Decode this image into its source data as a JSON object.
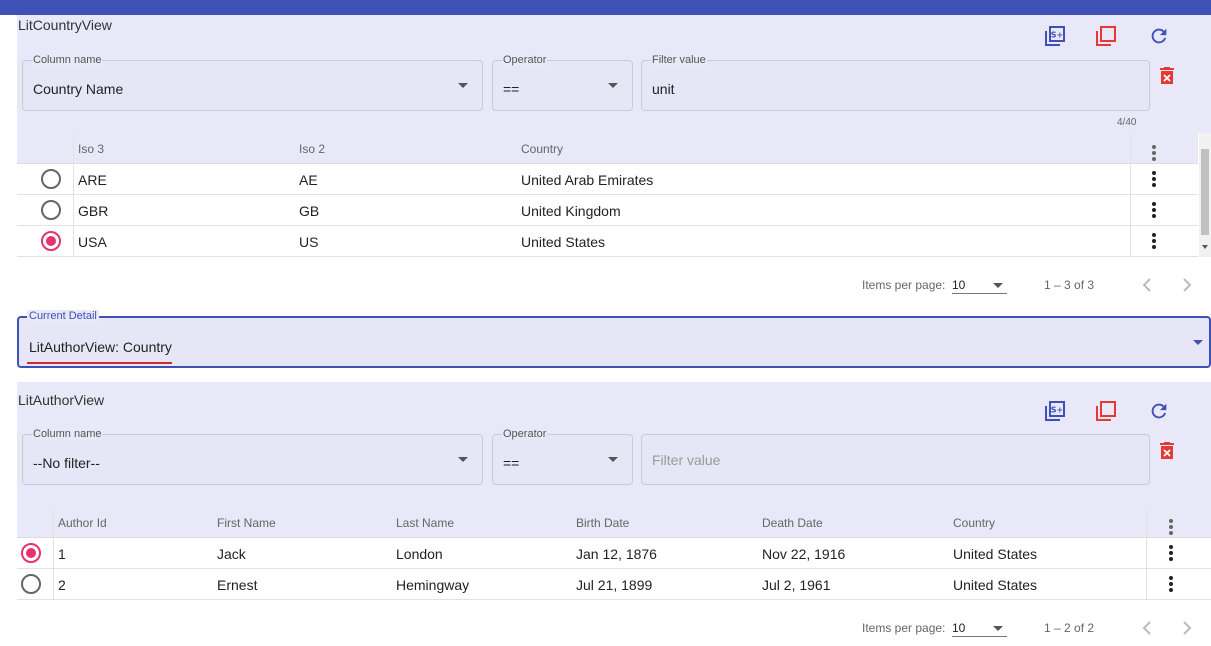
{
  "colors": {
    "primary": "#3f51b5",
    "accent": "#e5336e",
    "warn": "#e53935",
    "panel_bg": "#e8e8f8"
  },
  "country_view": {
    "title": "LitCountryView",
    "toolbar": {
      "add_icon": "library-add-icon",
      "copy_icon": "copy-icon",
      "refresh_icon": "refresh-icon",
      "delete_icon": "delete-filter-icon"
    },
    "filter": {
      "column_label": "Column name",
      "column_value": "Country Name",
      "operator_label": "Operator",
      "operator_value": "==",
      "value_label": "Filter value",
      "value_text": "unit",
      "char_count": "4/40"
    },
    "table": {
      "columns": [
        "Iso 3",
        "Iso 2",
        "Country"
      ],
      "rows": [
        {
          "selected": false,
          "iso3": "ARE",
          "iso2": "AE",
          "country": "United Arab Emirates"
        },
        {
          "selected": false,
          "iso3": "GBR",
          "iso2": "GB",
          "country": "United Kingdom"
        },
        {
          "selected": true,
          "iso3": "USA",
          "iso2": "US",
          "country": "United States"
        }
      ]
    },
    "paginator": {
      "items_label": "Items per page:",
      "page_size": "10",
      "range": "1 – 3 of 3"
    }
  },
  "current_detail": {
    "label": "Current Detail",
    "value": "LitAuthorView: Country"
  },
  "author_view": {
    "title": "LitAuthorView",
    "toolbar": {
      "add_icon": "library-add-icon",
      "copy_icon": "copy-icon",
      "refresh_icon": "refresh-icon",
      "delete_icon": "delete-filter-icon"
    },
    "filter": {
      "column_label": "Column name",
      "column_value": "--No filter--",
      "operator_label": "Operator",
      "operator_value": "==",
      "value_placeholder": "Filter value"
    },
    "table": {
      "columns": [
        "Author Id",
        "First Name",
        "Last Name",
        "Birth Date",
        "Death Date",
        "Country"
      ],
      "rows": [
        {
          "selected": true,
          "id": "1",
          "first": "Jack",
          "last": "London",
          "birth": "Jan 12, 1876",
          "death": "Nov 22, 1916",
          "country": "United States"
        },
        {
          "selected": false,
          "id": "2",
          "first": "Ernest",
          "last": "Hemingway",
          "birth": "Jul 21, 1899",
          "death": "Jul 2, 1961",
          "country": "United States"
        }
      ]
    },
    "paginator": {
      "items_label": "Items per page:",
      "page_size": "10",
      "range": "1 – 2 of 2"
    }
  }
}
